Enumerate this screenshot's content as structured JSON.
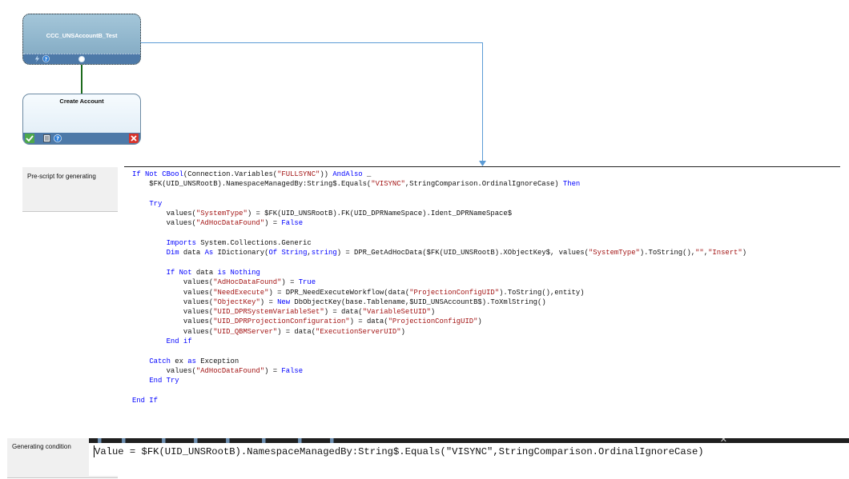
{
  "workflow": {
    "top_node": {
      "title": "CCC_UNSAccountB_Test"
    },
    "bottom_node": {
      "title": "Create Account"
    }
  },
  "properties": {
    "prescript_label": "Pre-script for generating",
    "condition_label": "Generating condition"
  },
  "script_lines": [
    [
      [
        "If Not CBool",
        "kw"
      ],
      [
        "(Connection.Variables(",
        ""
      ],
      [
        "\"FULLSYNC\"",
        "st"
      ],
      ")) ",
      [
        "AndAlso",
        "kw"
      ],
      " _"
    ],
    [
      "    $FK(UID_UNSRootB).NamespaceManagedBy:String$.Equals(",
      [
        "\"VISYNC\"",
        "st"
      ],
      ",StringComparison.OrdinalIgnoreCase) ",
      [
        "Then",
        "kw"
      ]
    ],
    [
      ""
    ],
    [
      "    ",
      [
        "Try",
        "kw"
      ]
    ],
    [
      "        values(",
      [
        "\"SystemType\"",
        "st"
      ],
      ") = $FK(UID_UNSRootB).FK(UID_DPRNameSpace).Ident_DPRNameSpace$"
    ],
    [
      "        values(",
      [
        "\"AdHocDataFound\"",
        "st"
      ],
      ") = ",
      [
        "False",
        "kw"
      ]
    ],
    [
      ""
    ],
    [
      "        ",
      [
        "Imports",
        "kw"
      ],
      " System.Collections.Generic"
    ],
    [
      "        ",
      [
        "Dim",
        "kw"
      ],
      " data ",
      [
        "As",
        "kw"
      ],
      " IDictionary(",
      [
        "Of String",
        "kw"
      ],
      ",",
      [
        "string",
        "kw"
      ],
      ") = DPR_GetAdHocData($FK(UID_UNSRootB).XObjectKey$, values(",
      [
        "\"SystemType\"",
        "st"
      ],
      ").ToString(),",
      [
        "\"\"",
        "st"
      ],
      ",",
      [
        "\"Insert\"",
        "st"
      ],
      ")"
    ],
    [
      ""
    ],
    [
      "        ",
      [
        "If Not",
        "kw"
      ],
      " data ",
      [
        "is Nothing",
        "kw"
      ]
    ],
    [
      "            values(",
      [
        "\"AdHocDataFound\"",
        "st"
      ],
      ") = ",
      [
        "True",
        "kw"
      ]
    ],
    [
      "            values(",
      [
        "\"NeedExecute\"",
        "st"
      ],
      ") = DPR_NeedExecuteWorkflow(data(",
      [
        "\"ProjectionConfigUID\"",
        "st"
      ],
      ").ToString(),entity)"
    ],
    [
      "            values(",
      [
        "\"ObjectKey\"",
        "st"
      ],
      ") = ",
      [
        "New",
        "kw"
      ],
      " DbObjectKey(base.Tablename,$UID_UNSAccountB$).ToXmlString()"
    ],
    [
      "            values(",
      [
        "\"UID_DPRSystemVariableSet\"",
        "st"
      ],
      ") = data(",
      [
        "\"VariableSetUID\"",
        "st"
      ],
      ")"
    ],
    [
      "            values(",
      [
        "\"UID_DPRProjectionConfiguration\"",
        "st"
      ],
      ") = data(",
      [
        "\"ProjectionConfigUID\"",
        "st"
      ],
      ")"
    ],
    [
      "            values(",
      [
        "\"UID_QBMServer\"",
        "st"
      ],
      ") = data(",
      [
        "\"ExecutionServerUID\"",
        "st"
      ],
      ")"
    ],
    [
      "        ",
      [
        "End if",
        "kw"
      ]
    ],
    [
      ""
    ],
    [
      "    ",
      [
        "Catch",
        "kw"
      ],
      " ex ",
      [
        "as",
        "kw"
      ],
      " Exception"
    ],
    [
      "        values(",
      [
        "\"AdHocDataFound\"",
        "st"
      ],
      ") = ",
      [
        "False",
        "kw"
      ]
    ],
    [
      "    ",
      [
        "End Try",
        "kw"
      ]
    ],
    [
      ""
    ],
    [
      [
        "End If",
        "kw"
      ]
    ]
  ],
  "condition_text": "Value = $FK(UID_UNSRootB).NamespaceManagedBy:String$.Equals(\"VISYNC\",StringComparison.OrdinalIgnoreCase)",
  "colors": {
    "keyword": "#0000ff",
    "string": "#a31515",
    "connector": "#5b9bd5",
    "node_footer": "#4d79a8"
  }
}
